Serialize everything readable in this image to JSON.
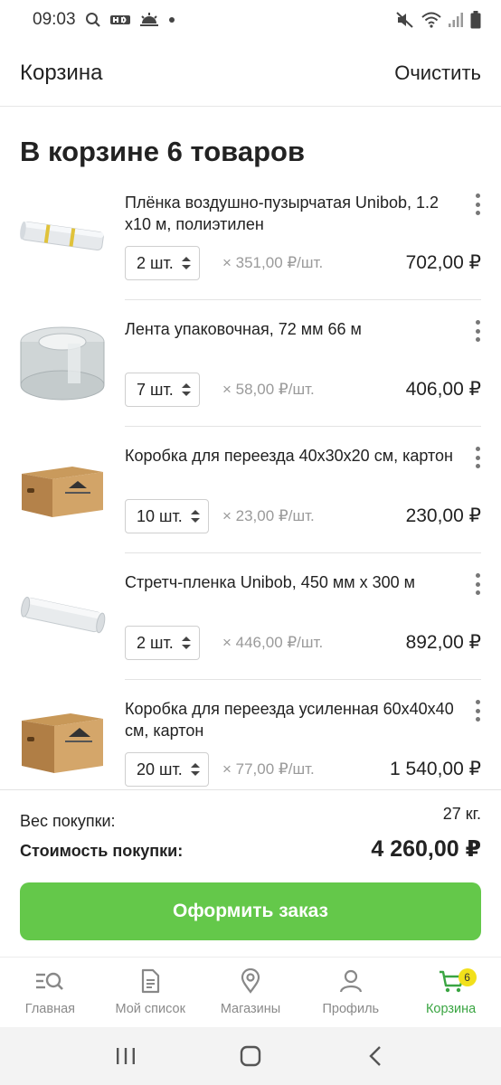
{
  "status_bar": {
    "time": "09:03"
  },
  "header": {
    "title": "Корзина",
    "clear_label": "Очистить"
  },
  "heading": "В корзине 6 товаров",
  "items": [
    {
      "name": "Плёнка воздушно-пузырчатая Unibob, 1.2 х10 м, полиэтилен",
      "qty": "2 шт.",
      "unit_price": "× 351,00  ₽/шт.",
      "total": "702,00 ₽",
      "image_icon": "bubble-wrap-roll-image"
    },
    {
      "name": "Лента упаковочная, 72 мм 66 м",
      "qty": "7 шт.",
      "unit_price": "× 58,00  ₽/шт.",
      "total": "406,00 ₽",
      "image_icon": "packing-tape-image"
    },
    {
      "name": "Коробка для переезда 40х30х20 см, картон",
      "qty": "10 шт.",
      "unit_price": "× 23,00  ₽/шт.",
      "total": "230,00 ₽",
      "image_icon": "cardboard-box-image"
    },
    {
      "name": "Стретч-пленка Unibob, 450 мм х 300 м",
      "qty": "2 шт.",
      "unit_price": "× 446,00  ₽/шт.",
      "total": "892,00 ₽",
      "image_icon": "stretch-film-image"
    },
    {
      "name": "Коробка для переезда усиленная 60х40х40 см, картон",
      "qty": "20 шт.",
      "unit_price": "× 77,00  ₽/шт.",
      "total": "1 540,00 ₽",
      "image_icon": "reinforced-box-image"
    }
  ],
  "summary": {
    "weight_label": "Вес покупки:",
    "weight_value": "27 кг.",
    "cost_label": "Стоимость покупки:",
    "cost_value": "4 260,00 ₽"
  },
  "checkout_label": "Оформить заказ",
  "bottom_nav": [
    {
      "label": "Главная",
      "icon": "home-search-icon"
    },
    {
      "label": "Мой список",
      "icon": "list-icon"
    },
    {
      "label": "Магазины",
      "icon": "location-pin-icon"
    },
    {
      "label": "Профиль",
      "icon": "profile-icon"
    },
    {
      "label": "Корзина",
      "icon": "cart-icon",
      "badge": "6",
      "active": true
    }
  ],
  "colors": {
    "accent": "#64c84a",
    "active_nav": "#3aa542",
    "badge": "#f2e01b"
  }
}
